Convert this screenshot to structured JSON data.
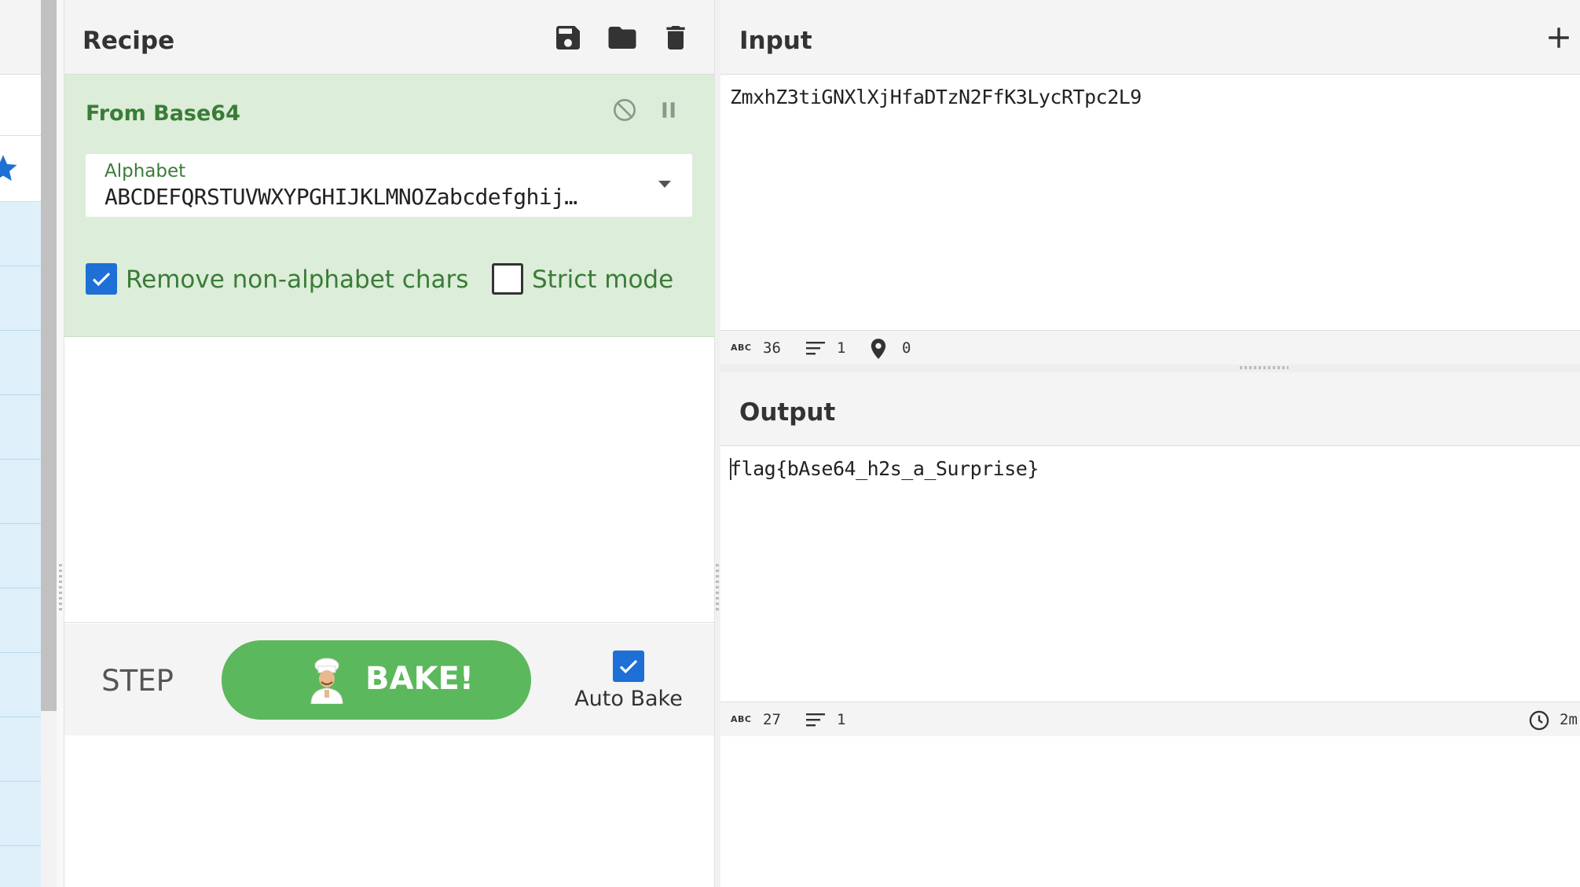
{
  "recipe": {
    "title": "Recipe",
    "operation": {
      "title": "From Base64",
      "alphabet_label": "Alphabet",
      "alphabet_value": "ABCDEFQRSTUVWXYPGHIJKLMNOZabcdefghij…",
      "remove_non_alphabet": {
        "label": "Remove non-alphabet chars",
        "checked": true
      },
      "strict_mode": {
        "label": "Strict mode",
        "checked": false
      }
    },
    "controls": {
      "step_label": "STEP",
      "bake_label": "BAKE!",
      "auto_bake_label": "Auto Bake",
      "auto_bake_checked": true
    }
  },
  "input": {
    "title": "Input",
    "text": "ZmxhZ3tiGNXlXjHfaDTzN2FfK3LycRTpc2L9",
    "status": {
      "length": "36",
      "lines": "1",
      "position": "0"
    }
  },
  "output": {
    "title": "Output",
    "text": "flag{bAse64_h2s_a_Surprise}",
    "status": {
      "length": "27",
      "lines": "1",
      "time": "2m"
    }
  },
  "labels": {
    "abc_badge": "ABC"
  },
  "colors": {
    "operation_bg": "#dcedd9",
    "operation_text": "#3a7c37",
    "bake_button": "#5cb85c",
    "checkbox_checked": "#1e6fd6",
    "favourite_star": "#1e6fd6",
    "ops_list_bg": "#dff0fa"
  },
  "icons": {
    "header": [
      "save-icon",
      "folder-icon",
      "trash-icon"
    ],
    "operation": [
      "disable-icon",
      "pause-icon"
    ],
    "input": [
      "add-input-icon"
    ],
    "status": [
      "length-icon",
      "lines-icon",
      "position-icon",
      "time-icon"
    ]
  }
}
